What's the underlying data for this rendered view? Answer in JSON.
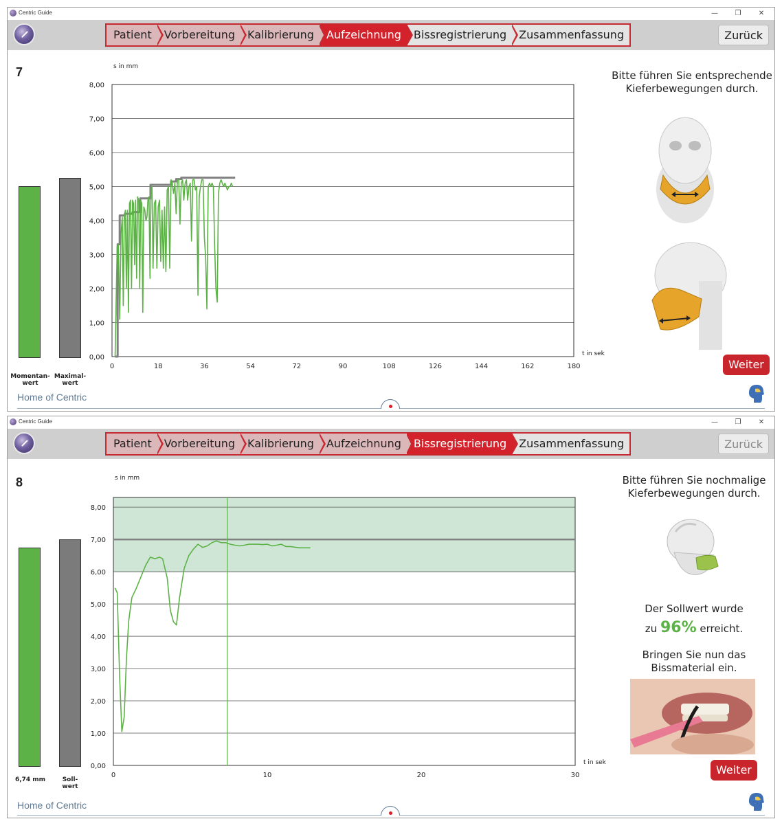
{
  "windows": [
    {
      "title": "Centric Guide",
      "controls": {
        "minimize": "—",
        "restore": "❐",
        "close": "✕"
      },
      "steps": [
        {
          "label": "Patient",
          "state": "done"
        },
        {
          "label": "Vorbereitung",
          "state": "done"
        },
        {
          "label": "Kalibrierung",
          "state": "done"
        },
        {
          "label": "Aufzeichnung",
          "state": "active"
        },
        {
          "label": "Bissregistrierung",
          "state": "todo"
        },
        {
          "label": "Zusammenfassung",
          "state": "todo"
        }
      ],
      "back_label": "Zurück",
      "back_enabled": true,
      "step_number": "7",
      "bar_current_label": "Momentan-\nwert",
      "bar_max_label": "Maximal-\nwert",
      "bar_current_value": 5.02,
      "bar_max_value": 5.26,
      "instruction": "Bitte führen Sie entsprechende Kieferbewegungen durch.",
      "next_label": "Weiter",
      "footer": "Home of Centric",
      "image_names": [
        "jaw-front-illustration",
        "jaw-side-illustration"
      ]
    },
    {
      "title": "Centric Guide",
      "controls": {
        "minimize": "—",
        "restore": "❐",
        "close": "✕"
      },
      "steps": [
        {
          "label": "Patient",
          "state": "done"
        },
        {
          "label": "Vorbereitung",
          "state": "done"
        },
        {
          "label": "Kalibrierung",
          "state": "done"
        },
        {
          "label": "Aufzeichnung",
          "state": "done"
        },
        {
          "label": "Bissregistrierung",
          "state": "active"
        },
        {
          "label": "Zusammenfassung",
          "state": "todo"
        }
      ],
      "back_label": "Zurück",
      "back_enabled": false,
      "step_number": "8",
      "bar_current_label": "6,74 mm",
      "bar_max_label": "Soll-\nwert",
      "bar_current_value": 6.74,
      "bar_max_value": 7.0,
      "instruction": "Bitte führen Sie nochmalige Kieferbewegungen durch.",
      "result_prefix": "Der Sollwert wurde",
      "result_zu": "zu",
      "result_percent": "96%",
      "result_suffix": "erreicht.",
      "material_text": "Bringen Sie nun das Bissmaterial ein.",
      "next_label": "Weiter",
      "footer": "Home of Centric",
      "image_names": [
        "skull-jaw-illustration",
        "bite-material-photo"
      ]
    }
  ],
  "colors": {
    "accent_red": "#d3222b",
    "step_done": "#dcb7b9",
    "bar_green": "#5db247",
    "bar_gray": "#7b7b7b",
    "target_band": "#cfe6d6",
    "line_green": "#5db247",
    "line_gray": "#808080"
  },
  "chart_data": [
    {
      "type": "line",
      "ylabel": "s in mm",
      "xlabel": "t in sek",
      "xlim": [
        0,
        180
      ],
      "ylim": [
        0,
        8
      ],
      "x_ticks": [
        "0",
        "18",
        "36",
        "54",
        "72",
        "90",
        "108",
        "126",
        "144",
        "162",
        "180"
      ],
      "y_ticks": [
        "0,00",
        "1,00",
        "2,00",
        "3,00",
        "4,00",
        "5,00",
        "6,00",
        "7,00",
        "8,00"
      ],
      "grid": "horizontal",
      "series": [
        {
          "role": "current",
          "color": "#5db247",
          "x": [
            1.2,
            2.0,
            2.5,
            3.0,
            3.5,
            4.0,
            4.4,
            4.8,
            5.2,
            5.6,
            6.0,
            6.4,
            6.8,
            7.2,
            7.6,
            8.0,
            8.4,
            8.8,
            9.2,
            9.6,
            10.0,
            10.4,
            10.8,
            11.2,
            11.6,
            12.0,
            12.4,
            12.8,
            13.2,
            13.6,
            14.0,
            14.4,
            14.8,
            15.2,
            15.6,
            16.0,
            16.5,
            17.0,
            17.5,
            18.0,
            18.5,
            19.0,
            19.5,
            20.0,
            20.5,
            21.0,
            21.5,
            22.0,
            22.5,
            23.0,
            23.5,
            24.0,
            24.5,
            25.0,
            25.5,
            26.0,
            26.5,
            27.0,
            27.5,
            28.0,
            28.5,
            29.0,
            29.5,
            30.0,
            30.5,
            31.0,
            31.5,
            32.0,
            32.5,
            33.0,
            33.5,
            34.0,
            34.5,
            35.0,
            35.5,
            36.0,
            36.5,
            37.0,
            37.5,
            38.0,
            38.5,
            39.0,
            39.5,
            40.0,
            40.5,
            41.0,
            41.5,
            42.0,
            42.5,
            43.0,
            43.5,
            44.0,
            44.5,
            45.0,
            45.5,
            46.0,
            46.5,
            47.0
          ],
          "y": [
            0.0,
            3.2,
            3.3,
            1.1,
            3.6,
            4.1,
            1.5,
            4.1,
            4.3,
            2.0,
            4.3,
            1.3,
            4.5,
            4.6,
            2.0,
            4.6,
            4.5,
            2.7,
            4.6,
            2.3,
            4.7,
            4.6,
            2.0,
            4.6,
            4.5,
            1.3,
            4.4,
            4.3,
            4.0,
            4.1,
            4.6,
            4.7,
            2.3,
            4.9,
            5.0,
            2.6,
            4.5,
            4.6,
            2.6,
            4.4,
            4.6,
            2.8,
            4.3,
            2.6,
            4.4,
            2.5,
            4.9,
            5.0,
            2.6,
            5.2,
            5.1,
            4.8,
            5.1,
            4.2,
            5.2,
            5.2,
            3.9,
            5.1,
            5.2,
            4.6,
            5.1,
            5.2,
            4.6,
            5.0,
            5.1,
            3.4,
            5.2,
            5.2,
            4.9,
            5.0,
            1.8,
            4.7,
            5.0,
            5.2,
            5.2,
            3.5,
            2.9,
            1.4,
            5.0,
            5.1,
            5.0,
            5.1,
            5.0,
            3.3,
            2.0,
            1.6,
            4.8,
            5.1,
            5.2,
            5.1,
            5.0,
            5.1,
            5.0,
            4.9,
            5.0,
            5.0,
            5.1,
            5.0
          ]
        },
        {
          "role": "maximum",
          "color": "#808080",
          "x": [
            1.2,
            2.2,
            2.2,
            3.0,
            3.0,
            5.0,
            5.0,
            8.0,
            8.0,
            11.0,
            11.0,
            15.0,
            15.0,
            23.0,
            23.0,
            25.0,
            25.0,
            27.0,
            27.0,
            48.0
          ],
          "y": [
            0.0,
            0.0,
            3.3,
            3.3,
            4.15,
            4.15,
            4.2,
            4.2,
            4.25,
            4.25,
            4.65,
            4.65,
            5.05,
            5.05,
            5.15,
            5.15,
            5.22,
            5.22,
            5.26,
            5.26
          ]
        }
      ]
    },
    {
      "type": "line",
      "ylabel": "s in mm",
      "xlabel": "t in sek",
      "xlim": [
        0,
        30
      ],
      "ylim": [
        0,
        8.3
      ],
      "x_ticks": [
        "0",
        "10",
        "20",
        "30"
      ],
      "y_ticks": [
        "0,00",
        "1,00",
        "2,00",
        "3,00",
        "4,00",
        "5,00",
        "6,00",
        "7,00",
        "8,00"
      ],
      "target_band": [
        6.0,
        8.3
      ],
      "target_line": 7.0,
      "marker_x": 7.4,
      "series": [
        {
          "role": "current",
          "color": "#5db247",
          "x": [
            0.1,
            0.25,
            0.4,
            0.55,
            0.7,
            0.85,
            1.0,
            1.2,
            1.5,
            1.8,
            2.1,
            2.4,
            2.7,
            3.0,
            3.2,
            3.5,
            3.7,
            3.9,
            4.1,
            4.3,
            4.6,
            4.9,
            5.2,
            5.5,
            5.8,
            6.1,
            6.4,
            6.7,
            7.0,
            7.3,
            7.6,
            7.9,
            8.2,
            8.5,
            8.8,
            9.1,
            9.4,
            9.7,
            10.0,
            10.3,
            10.6,
            10.9,
            11.2,
            11.5,
            11.8,
            12.1,
            12.4,
            12.8
          ],
          "y": [
            5.5,
            5.35,
            2.8,
            1.05,
            1.5,
            3.3,
            4.5,
            5.2,
            5.5,
            5.85,
            6.2,
            6.45,
            6.4,
            6.45,
            6.4,
            5.8,
            4.8,
            4.45,
            4.35,
            5.2,
            6.1,
            6.5,
            6.7,
            6.85,
            6.75,
            6.8,
            6.9,
            6.95,
            6.9,
            6.9,
            6.85,
            6.82,
            6.8,
            6.82,
            6.85,
            6.85,
            6.85,
            6.84,
            6.85,
            6.8,
            6.82,
            6.85,
            6.78,
            6.78,
            6.76,
            6.74,
            6.74,
            6.74
          ]
        }
      ]
    }
  ]
}
